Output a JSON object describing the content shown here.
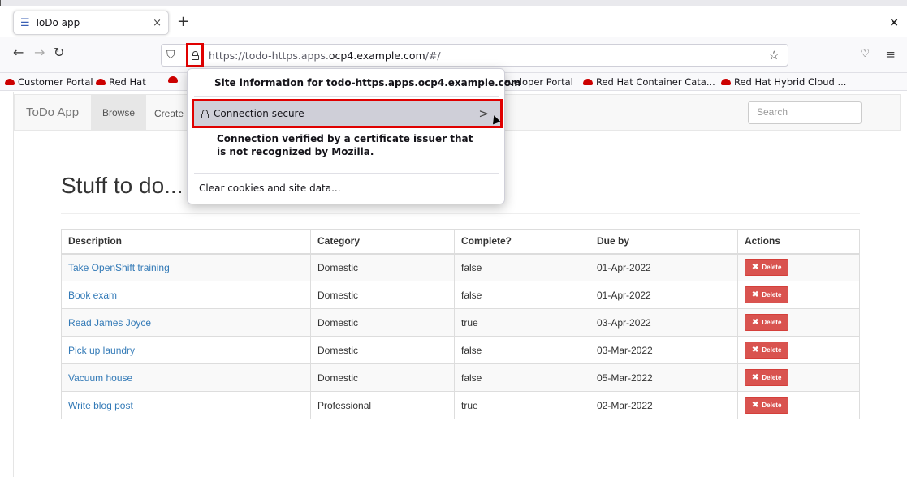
{
  "browser": {
    "tab_title": "ToDo app",
    "tab_icon": "list-icon",
    "new_tab": "+",
    "tab_close": "×",
    "window_close": "×",
    "url_prefix": "https://todo-https.apps.",
    "url_domain": "ocp4.example.com",
    "url_suffix": "/#/",
    "bookmarks": [
      "Customer Portal",
      "Red Hat",
      "Developer Portal",
      "Red Hat Container Cata...",
      "Red Hat Hybrid Cloud ..."
    ]
  },
  "popup": {
    "title": "Site information for todo-https.apps.ocp4.example.com",
    "connection_label": "Connection secure",
    "verified_text": "Connection verified by a certificate issuer that is not recognized by Mozilla.",
    "clear_label": "Clear cookies and site data..."
  },
  "app": {
    "brand": "ToDo App",
    "nav_browse": "Browse",
    "nav_create": "Create",
    "search_placeholder": "Search",
    "heading": "Stuff to do...",
    "columns": [
      "Description",
      "Category",
      "Complete?",
      "Due by",
      "Actions"
    ],
    "delete_label": "Delete",
    "rows": [
      {
        "description": "Take OpenShift training",
        "category": "Domestic",
        "complete": "false",
        "due": "01-Apr-2022"
      },
      {
        "description": "Book exam",
        "category": "Domestic",
        "complete": "false",
        "due": "01-Apr-2022"
      },
      {
        "description": "Read James Joyce",
        "category": "Domestic",
        "complete": "true",
        "due": "03-Apr-2022"
      },
      {
        "description": "Pick up laundry",
        "category": "Domestic",
        "complete": "false",
        "due": "03-Mar-2022"
      },
      {
        "description": "Vacuum house",
        "category": "Domestic",
        "complete": "false",
        "due": "05-Mar-2022"
      },
      {
        "description": "Write blog post",
        "category": "Professional",
        "complete": "true",
        "due": "02-Mar-2022"
      }
    ]
  },
  "colors": {
    "highlight": "#e00000",
    "link": "#337ab7",
    "danger": "#d9534f"
  }
}
